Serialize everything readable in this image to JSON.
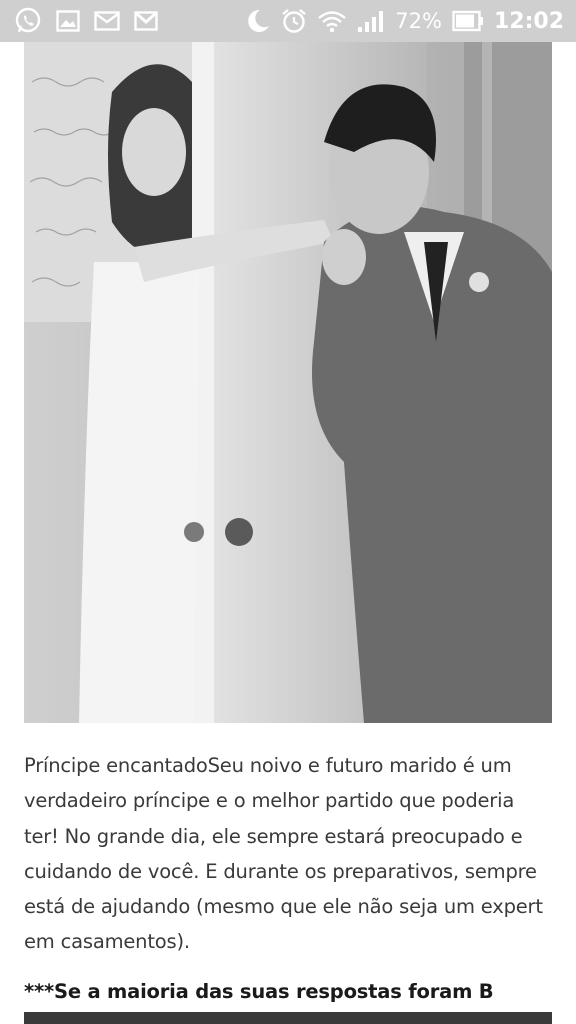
{
  "status_bar": {
    "battery_percent": "72%",
    "time": "12:02",
    "notification_icons": [
      "whatsapp-icon",
      "gallery-icon",
      "email-icon",
      "gmail-icon"
    ],
    "system_icons": [
      "do-not-disturb-moon-icon",
      "alarm-icon",
      "wifi-icon",
      "signal-icon",
      "battery-icon"
    ]
  },
  "article": {
    "image_alt": "",
    "body_text": "Príncipe encantadoSeu noivo e futuro marido é um verdadeiro príncipe e o melhor partido que poderia ter! No grande dia, ele sempre estará preocupado e cuidando de você. E durante os preparativos, sempre está de ajudando (mesmo que ele não seja um expert em casamentos).",
    "next_heading": "***Se a maioria das suas respostas foram B"
  }
}
